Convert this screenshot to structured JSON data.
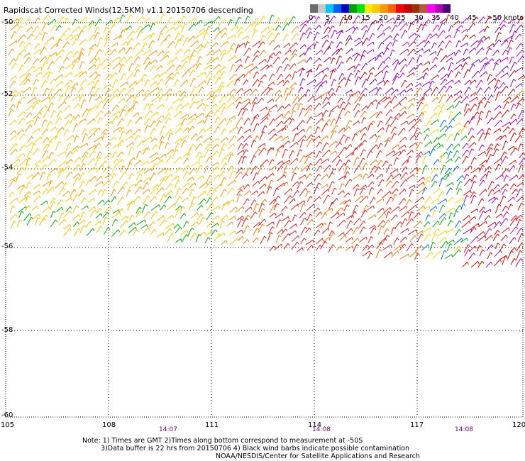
{
  "header": {
    "title": "Rapidscat Corrected Winds(12.5KM) v1.1 20150706 descending"
  },
  "legend": {
    "colors": [
      "#6e6e6e",
      "#c8c8c8",
      "#00c8ff",
      "#0064ff",
      "#0000c8",
      "#00a000",
      "#00e600",
      "#ffe600",
      "#ffc800",
      "#ff9600",
      "#ff6400",
      "#ff0000",
      "#c80000",
      "#963200",
      "#b45a3c",
      "#ff00ff",
      "#b400b4",
      "#500078"
    ],
    "labels": [
      "0",
      "5",
      "10",
      "15",
      "20",
      "25",
      "30",
      "35",
      "40",
      "45",
      ">50 knots"
    ]
  },
  "axes": {
    "lat_labels": [
      "-50",
      "-52",
      "-54",
      "-56",
      "-58",
      "-60"
    ],
    "lon_labels": [
      "105",
      "108",
      "111",
      "114",
      "117",
      "120"
    ],
    "time_labels": [
      "14:07",
      "14:08",
      "14:08"
    ]
  },
  "notes": {
    "line1": "Note: 1) Times are GMT 2)Times along bottom correspond to measurement at -50S",
    "line2": "3)Data buffer is 22 hrs from 20150706 4) Black wind barbs indicate possible contamination",
    "line3": "NOAA/NESDIS/Center for Satellite Applications and Research"
  },
  "map": {
    "lon_range": [
      105,
      120
    ],
    "lat_range": [
      -60,
      -50
    ],
    "grid": "dotted"
  }
}
